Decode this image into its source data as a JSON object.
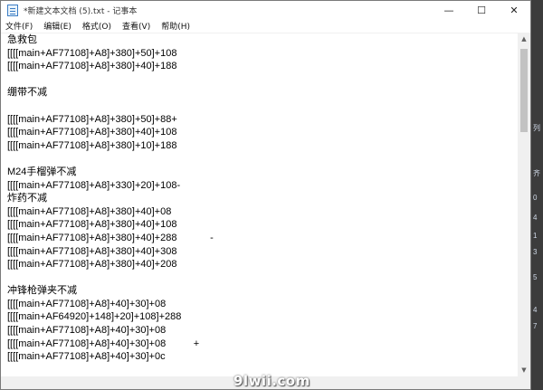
{
  "window": {
    "title": "*新建文本文档 (5).txt - 记事本",
    "minimize_glyph": "—",
    "maximize_glyph": "☐",
    "close_glyph": "✕"
  },
  "menu": [
    "文件(F)",
    "编辑(E)",
    "格式(O)",
    "查看(V)",
    "帮助(H)"
  ],
  "lines": [
    "急救包",
    "[[[[main+AF77108]+A8]+380]+50]+108",
    "[[[[main+AF77108]+A8]+380]+40]+188",
    "",
    "绷带不减",
    "",
    "[[[[main+AF77108]+A8]+380]+50]+88+",
    "[[[[main+AF77108]+A8]+380]+40]+108",
    "[[[[main+AF77108]+A8]+380]+10]+188",
    "",
    "M24手榴弹不减",
    "[[[[main+AF77108]+A8]+330]+20]+108-",
    "炸药不减",
    "[[[[main+AF77108]+A8]+380]+40]+08",
    "[[[[main+AF77108]+A8]+380]+40]+108",
    "[[[[main+AF77108]+A8]+380]+40]+288            -",
    "[[[[main+AF77108]+A8]+380]+40]+308",
    "[[[[main+AF77108]+A8]+380]+40]+208",
    "",
    "冲锋枪弹夹不减",
    "[[[[main+AF77108]+A8]+40]+30]+08",
    "[[[[main+AF64920]+148]+20]+108]+288",
    "[[[[main+AF77108]+A8]+40]+30]+08",
    "[[[[main+AF77108]+A8]+40]+30]+08          +",
    "[[[[main+AF77108]+A8]+40]+30]+0c"
  ],
  "scrollbar": {
    "up_arrow": "▲",
    "down_arrow": "▼"
  },
  "side_strip_chars": [
    "列",
    "齐",
    "0",
    "4",
    "1",
    "3",
    "5",
    "4",
    "7"
  ],
  "watermark": "9lwii.com"
}
